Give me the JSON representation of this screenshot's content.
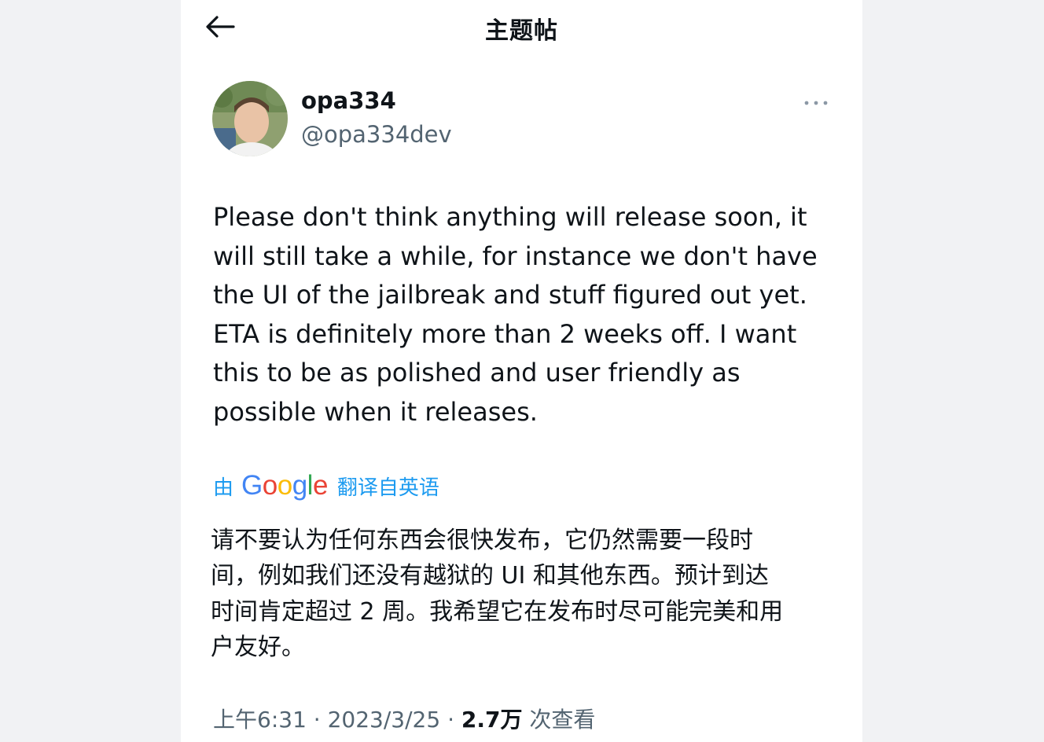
{
  "header": {
    "title": "主题帖"
  },
  "author": {
    "display_name": "opa334",
    "handle": "@opa334dev"
  },
  "tweet": {
    "lines": [
      "Please don't think anything will release soon, it",
      "will still take a while, for instance we don't have",
      "the UI of the jailbreak and stuff figured out yet.",
      "ETA is definitely more than 2 weeks off. I want",
      "this to be as polished and user friendly as",
      "possible when it releases."
    ]
  },
  "translation": {
    "prefix": "由",
    "brand": "Google",
    "brand_colors": [
      "#4285F4",
      "#EA4335",
      "#FBBC05",
      "#4285F4",
      "#34A853",
      "#EA4335"
    ],
    "suffix": "翻译自英语",
    "lines": [
      "请不要认为任何东西会很快发布，它仍然需要一段时",
      "间，例如我们还没有越狱的 UI 和其他东西。预计到达",
      "时间肯定超过 2 周。我希望它在发布时尽可能完美和用",
      "户友好。"
    ]
  },
  "meta": {
    "time": "上午6:31",
    "separator": " · ",
    "date": "2023/3/25",
    "views_count": "2.7万",
    "views_label": "次查看"
  },
  "colors": {
    "text": "#0f1419",
    "secondary": "#536471",
    "accent": "#1d9bf0",
    "background": "#ffffff",
    "page_background": "#f1f2f4"
  },
  "icons": {
    "back": "arrow-left-icon",
    "more": "more-horizontal-icon"
  }
}
